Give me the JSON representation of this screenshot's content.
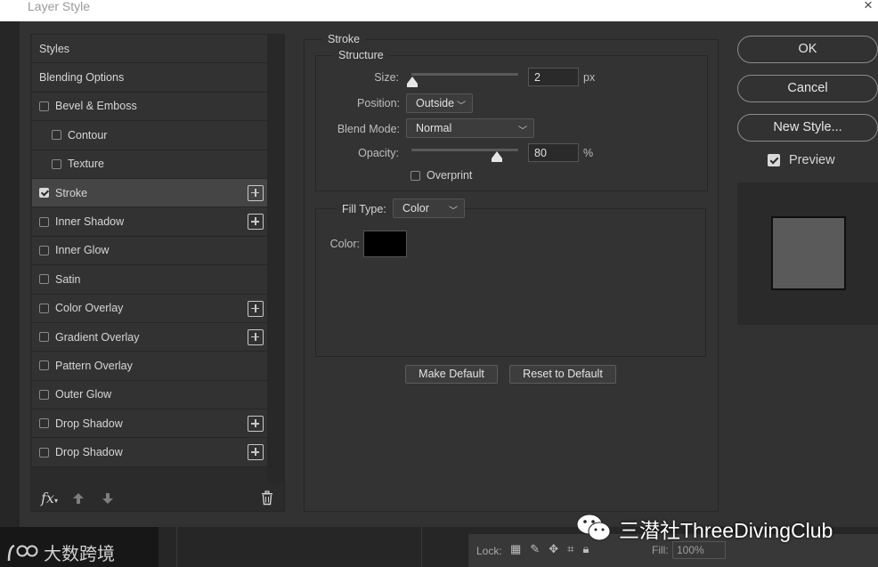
{
  "window": {
    "title": "Layer Style",
    "close": "×"
  },
  "styles": {
    "items": [
      {
        "label": "Styles",
        "checkbox": false,
        "checked": false,
        "plus": false,
        "indent": false,
        "selected": false
      },
      {
        "label": "Blending Options",
        "checkbox": false,
        "checked": false,
        "plus": false,
        "indent": false,
        "selected": false
      },
      {
        "label": "Bevel & Emboss",
        "checkbox": true,
        "checked": false,
        "plus": false,
        "indent": false,
        "selected": false
      },
      {
        "label": "Contour",
        "checkbox": true,
        "checked": false,
        "plus": false,
        "indent": true,
        "selected": false
      },
      {
        "label": "Texture",
        "checkbox": true,
        "checked": false,
        "plus": false,
        "indent": true,
        "selected": false
      },
      {
        "label": "Stroke",
        "checkbox": true,
        "checked": true,
        "plus": true,
        "indent": false,
        "selected": true
      },
      {
        "label": "Inner Shadow",
        "checkbox": true,
        "checked": false,
        "plus": true,
        "indent": false,
        "selected": false
      },
      {
        "label": "Inner Glow",
        "checkbox": true,
        "checked": false,
        "plus": false,
        "indent": false,
        "selected": false
      },
      {
        "label": "Satin",
        "checkbox": true,
        "checked": false,
        "plus": false,
        "indent": false,
        "selected": false
      },
      {
        "label": "Color Overlay",
        "checkbox": true,
        "checked": false,
        "plus": true,
        "indent": false,
        "selected": false
      },
      {
        "label": "Gradient Overlay",
        "checkbox": true,
        "checked": false,
        "plus": true,
        "indent": false,
        "selected": false
      },
      {
        "label": "Pattern Overlay",
        "checkbox": true,
        "checked": false,
        "plus": false,
        "indent": false,
        "selected": false
      },
      {
        "label": "Outer Glow",
        "checkbox": true,
        "checked": false,
        "plus": false,
        "indent": false,
        "selected": false
      },
      {
        "label": "Drop Shadow",
        "checkbox": true,
        "checked": false,
        "plus": true,
        "indent": false,
        "selected": false
      },
      {
        "label": "Drop Shadow",
        "checkbox": true,
        "checked": false,
        "plus": true,
        "indent": false,
        "selected": false
      }
    ],
    "tools": {
      "fx": "fx",
      "up": "🡅",
      "down": "🡇"
    }
  },
  "stroke": {
    "group_title": "Stroke",
    "structure_title": "Structure",
    "size_label": "Size:",
    "size_value": "2",
    "size_unit": "px",
    "size_fraction": 0.0,
    "position_label": "Position:",
    "position_value": "Outside",
    "blend_label": "Blend Mode:",
    "blend_value": "Normal",
    "opacity_label": "Opacity:",
    "opacity_value": "80",
    "opacity_unit": "%",
    "opacity_fraction": 0.8,
    "overprint_label": "Overprint",
    "overprint_checked": false,
    "filltype_label": "Fill Type:",
    "filltype_value": "Color",
    "color_label": "Color:",
    "color_value": "#000000",
    "make_default": "Make Default",
    "reset_default": "Reset to Default"
  },
  "buttons": {
    "ok": "OK",
    "cancel": "Cancel",
    "new_style": "New Style..."
  },
  "preview": {
    "label": "Preview",
    "checked": true,
    "swatch_color": "#5a5a5a"
  },
  "background": {
    "lock_label": "Lock:",
    "fill_label": "Fill:",
    "fill_value": "100%"
  },
  "watermarks": {
    "left": "大数跨境",
    "right": "三潜社ThreeDivingClub"
  }
}
